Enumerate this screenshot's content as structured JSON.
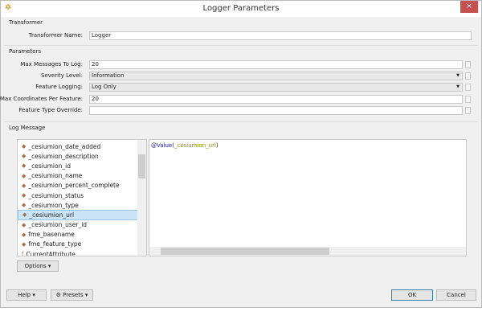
{
  "window": {
    "title": "Logger Parameters",
    "close": "×"
  },
  "transformer": {
    "section": "Transformer",
    "name_label": "Transformer Name:",
    "name_value": "Logger"
  },
  "parameters": {
    "section": "Parameters",
    "fields": [
      {
        "label": "Max Messages To Log:",
        "value": "20",
        "type": "text"
      },
      {
        "label": "Severity Level:",
        "value": "Information",
        "type": "select"
      },
      {
        "label": "Feature Logging:",
        "value": "Log Only",
        "type": "select"
      },
      {
        "label": "Max Coordinates Per Feature:",
        "value": "20",
        "type": "text"
      },
      {
        "label": "Feature Type Override:",
        "value": "",
        "type": "text"
      }
    ]
  },
  "log_message": {
    "section": "Log Message",
    "attributes": [
      "_cesiumion_date_added",
      "_cesiumion_description",
      "_cesiumion_id",
      "_cesiumion_name",
      "_cesiumion_percent_complete",
      "_cesiumion_status",
      "_cesiumion_type",
      "_cesiumion_url",
      "_cesiumion_user_id",
      "fme_basename",
      "fme_feature_type",
      "CurrentAttribute"
    ],
    "selected": "_cesiumion_url",
    "expression_func": "@Value(",
    "expression_arg": "_cesiumion_url",
    "expression_close": ")",
    "options_label": "Options"
  },
  "footer": {
    "help": "Help",
    "presets": "Presets",
    "ok": "OK",
    "cancel": "Cancel"
  }
}
